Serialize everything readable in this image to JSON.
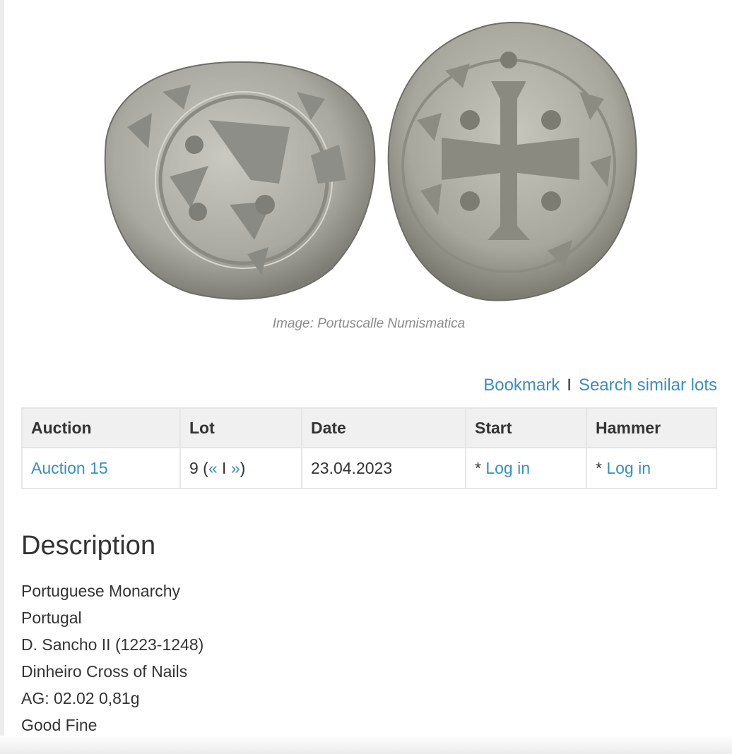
{
  "image": {
    "caption": "Image: Portuscalle Numismatica"
  },
  "actions": {
    "bookmark": "Bookmark",
    "separator": "I",
    "search_similar": "Search similar lots"
  },
  "table": {
    "headers": [
      "Auction",
      "Lot",
      "Date",
      "Start",
      "Hammer"
    ],
    "row": {
      "auction": "Auction 15",
      "lot_number": "9 (",
      "lot_prev": "«",
      "lot_sep": " I ",
      "lot_next": "»",
      "lot_close": ")",
      "date": "23.04.2023",
      "start_prefix": "* ",
      "start_link": "Log in",
      "hammer_prefix": "* ",
      "hammer_link": "Log in"
    }
  },
  "description": {
    "title": "Description",
    "lines": [
      "Portuguese Monarchy",
      "Portugal",
      "D. Sancho II (1223-1248)",
      "Dinheiro Cross of Nails",
      "AG: 02.02 0,81g",
      "Good Fine"
    ]
  }
}
